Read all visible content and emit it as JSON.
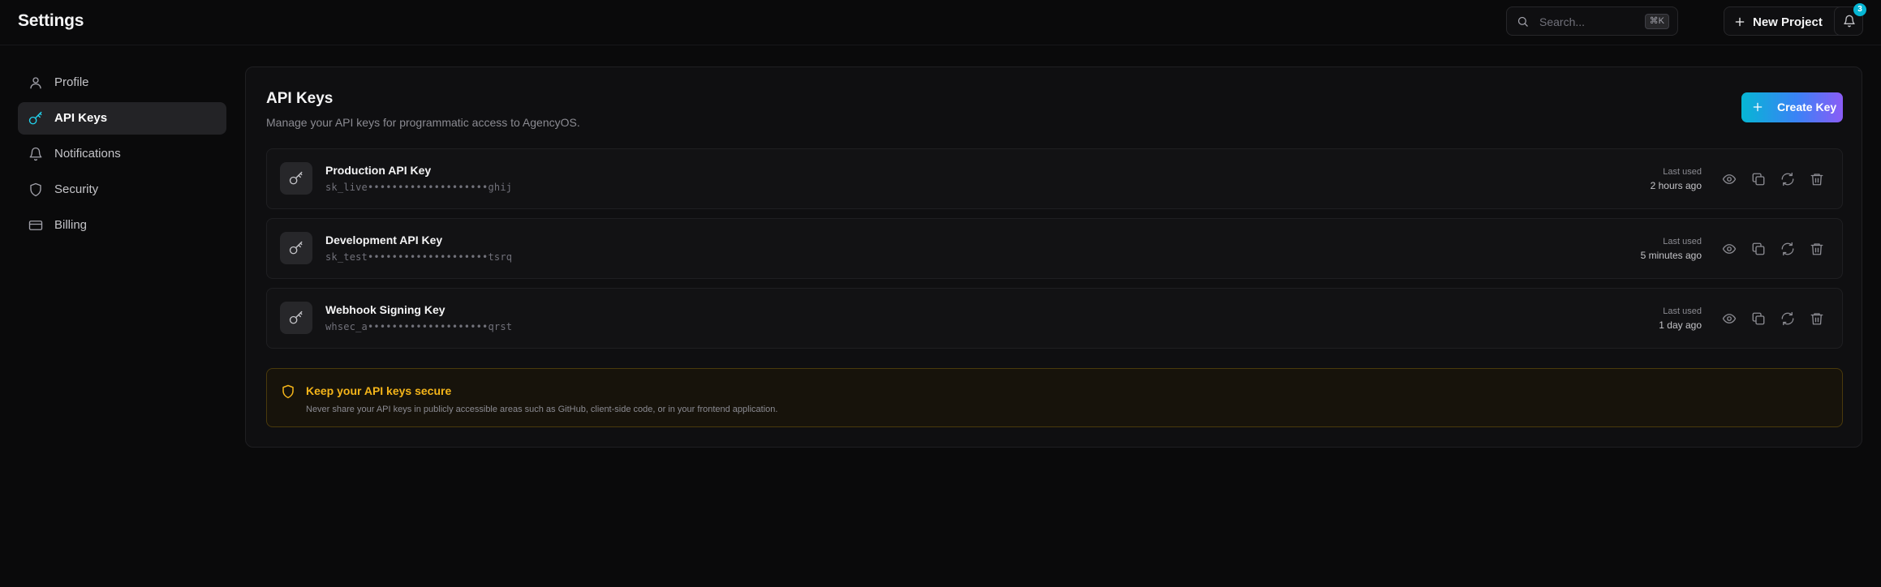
{
  "header": {
    "title": "Settings",
    "search_placeholder": "Search...",
    "search_shortcut": "⌘K",
    "new_project_label": "New Project",
    "notification_count": "3"
  },
  "sidebar": {
    "items": [
      {
        "label": "Profile",
        "icon": "user-icon",
        "active": false
      },
      {
        "label": "API Keys",
        "icon": "key-icon",
        "active": true
      },
      {
        "label": "Notifications",
        "icon": "bell-icon",
        "active": false
      },
      {
        "label": "Security",
        "icon": "shield-icon",
        "active": false
      },
      {
        "label": "Billing",
        "icon": "credit-card-icon",
        "active": false
      }
    ]
  },
  "main": {
    "title": "API Keys",
    "subtitle": "Manage your API keys for programmatic access to AgencyOS.",
    "create_key_label": "Create Key",
    "keys": [
      {
        "name": "Production API Key",
        "masked": "sk_live••••••••••••••••••••ghij",
        "last_used_label": "Last used",
        "last_used": "2 hours ago"
      },
      {
        "name": "Development API Key",
        "masked": "sk_test••••••••••••••••••••tsrq",
        "last_used_label": "Last used",
        "last_used": "5 minutes ago"
      },
      {
        "name": "Webhook Signing Key",
        "masked": "whsec_a••••••••••••••••••••qrst",
        "last_used_label": "Last used",
        "last_used": "1 day ago"
      }
    ],
    "warning": {
      "title": "Keep your API keys secure",
      "text": "Never share your API keys in publicly accessible areas such as GitHub, client-side code, or in your frontend application."
    }
  },
  "colors": {
    "background": "#0a0a0b",
    "accent_cyan": "#06b6d4",
    "accent_purple": "#8b5cf6",
    "warning": "#f5b51a"
  }
}
